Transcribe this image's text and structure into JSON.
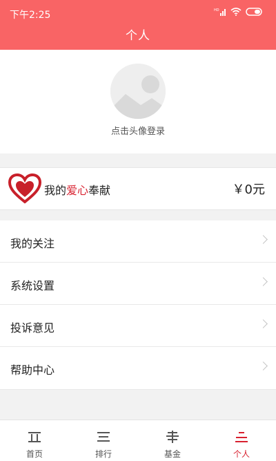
{
  "status_bar": {
    "time": "下午2:25",
    "network": "HD"
  },
  "header": {
    "title": "个人"
  },
  "profile": {
    "login_text": "点击头像登录"
  },
  "donation": {
    "label_prefix": "我的",
    "label_highlight": "爱心",
    "label_suffix": "奉献",
    "amount": "￥0元",
    "highlight_color": "#d8202f"
  },
  "menu": {
    "items": [
      {
        "label": "我的关注"
      },
      {
        "label": "系统设置"
      },
      {
        "label": "投诉意见"
      },
      {
        "label": "帮助中心"
      }
    ]
  },
  "tabbar": {
    "tabs": [
      {
        "label": "首页",
        "icon": "home-tab-icon"
      },
      {
        "label": "排行",
        "icon": "ranking-tab-icon"
      },
      {
        "label": "基金",
        "icon": "fund-tab-icon"
      },
      {
        "label": "个人",
        "icon": "personal-tab-icon",
        "active": true
      }
    ]
  },
  "colors": {
    "header": "#f96465",
    "accent": "#d8202f"
  }
}
